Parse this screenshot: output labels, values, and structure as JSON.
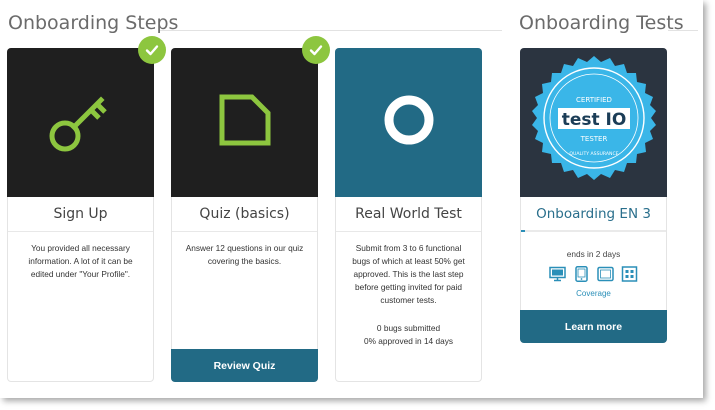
{
  "colors": {
    "accent_green": "#8dc63f",
    "teal": "#226a85",
    "link_blue": "#2a8fb8",
    "badge_blue": "#3ab6e8"
  },
  "steps_section": {
    "title": "Onboarding Steps"
  },
  "tests_section": {
    "title": "Onboarding Tests"
  },
  "steps": [
    {
      "title": "Sign Up",
      "icon": "key-icon",
      "completed": true,
      "description": "You provided all necessary information. A lot of it can be edited under \"Your Profile\"."
    },
    {
      "title": "Quiz (basics)",
      "icon": "document-icon",
      "completed": true,
      "description": "Answer 12 questions in our quiz covering the basics.",
      "action_label": "Review Quiz"
    },
    {
      "title": "Real World Test",
      "icon": "ring-icon",
      "completed": false,
      "description": "Submit from 3 to 6 functional bugs of which at least 50% get approved. This is the last step before getting invited for paid customer tests.",
      "stats_line1": "0 bugs submitted",
      "stats_line2": "0% approved in 14 days"
    }
  ],
  "test_card": {
    "badge": {
      "top_label": "CERTIFIED",
      "main_text": "test IO",
      "bottom_label": "TESTER",
      "arc_text": "QUALITY ASSURANCE"
    },
    "title": "Onboarding EN 3",
    "progress_fraction": 0.03,
    "ends": "ends in 2 days",
    "devices": [
      "desktop-icon",
      "smartphone-icon",
      "tablet-icon",
      "grid-icon"
    ],
    "coverage_label": "Coverage",
    "action_label": "Learn more"
  }
}
